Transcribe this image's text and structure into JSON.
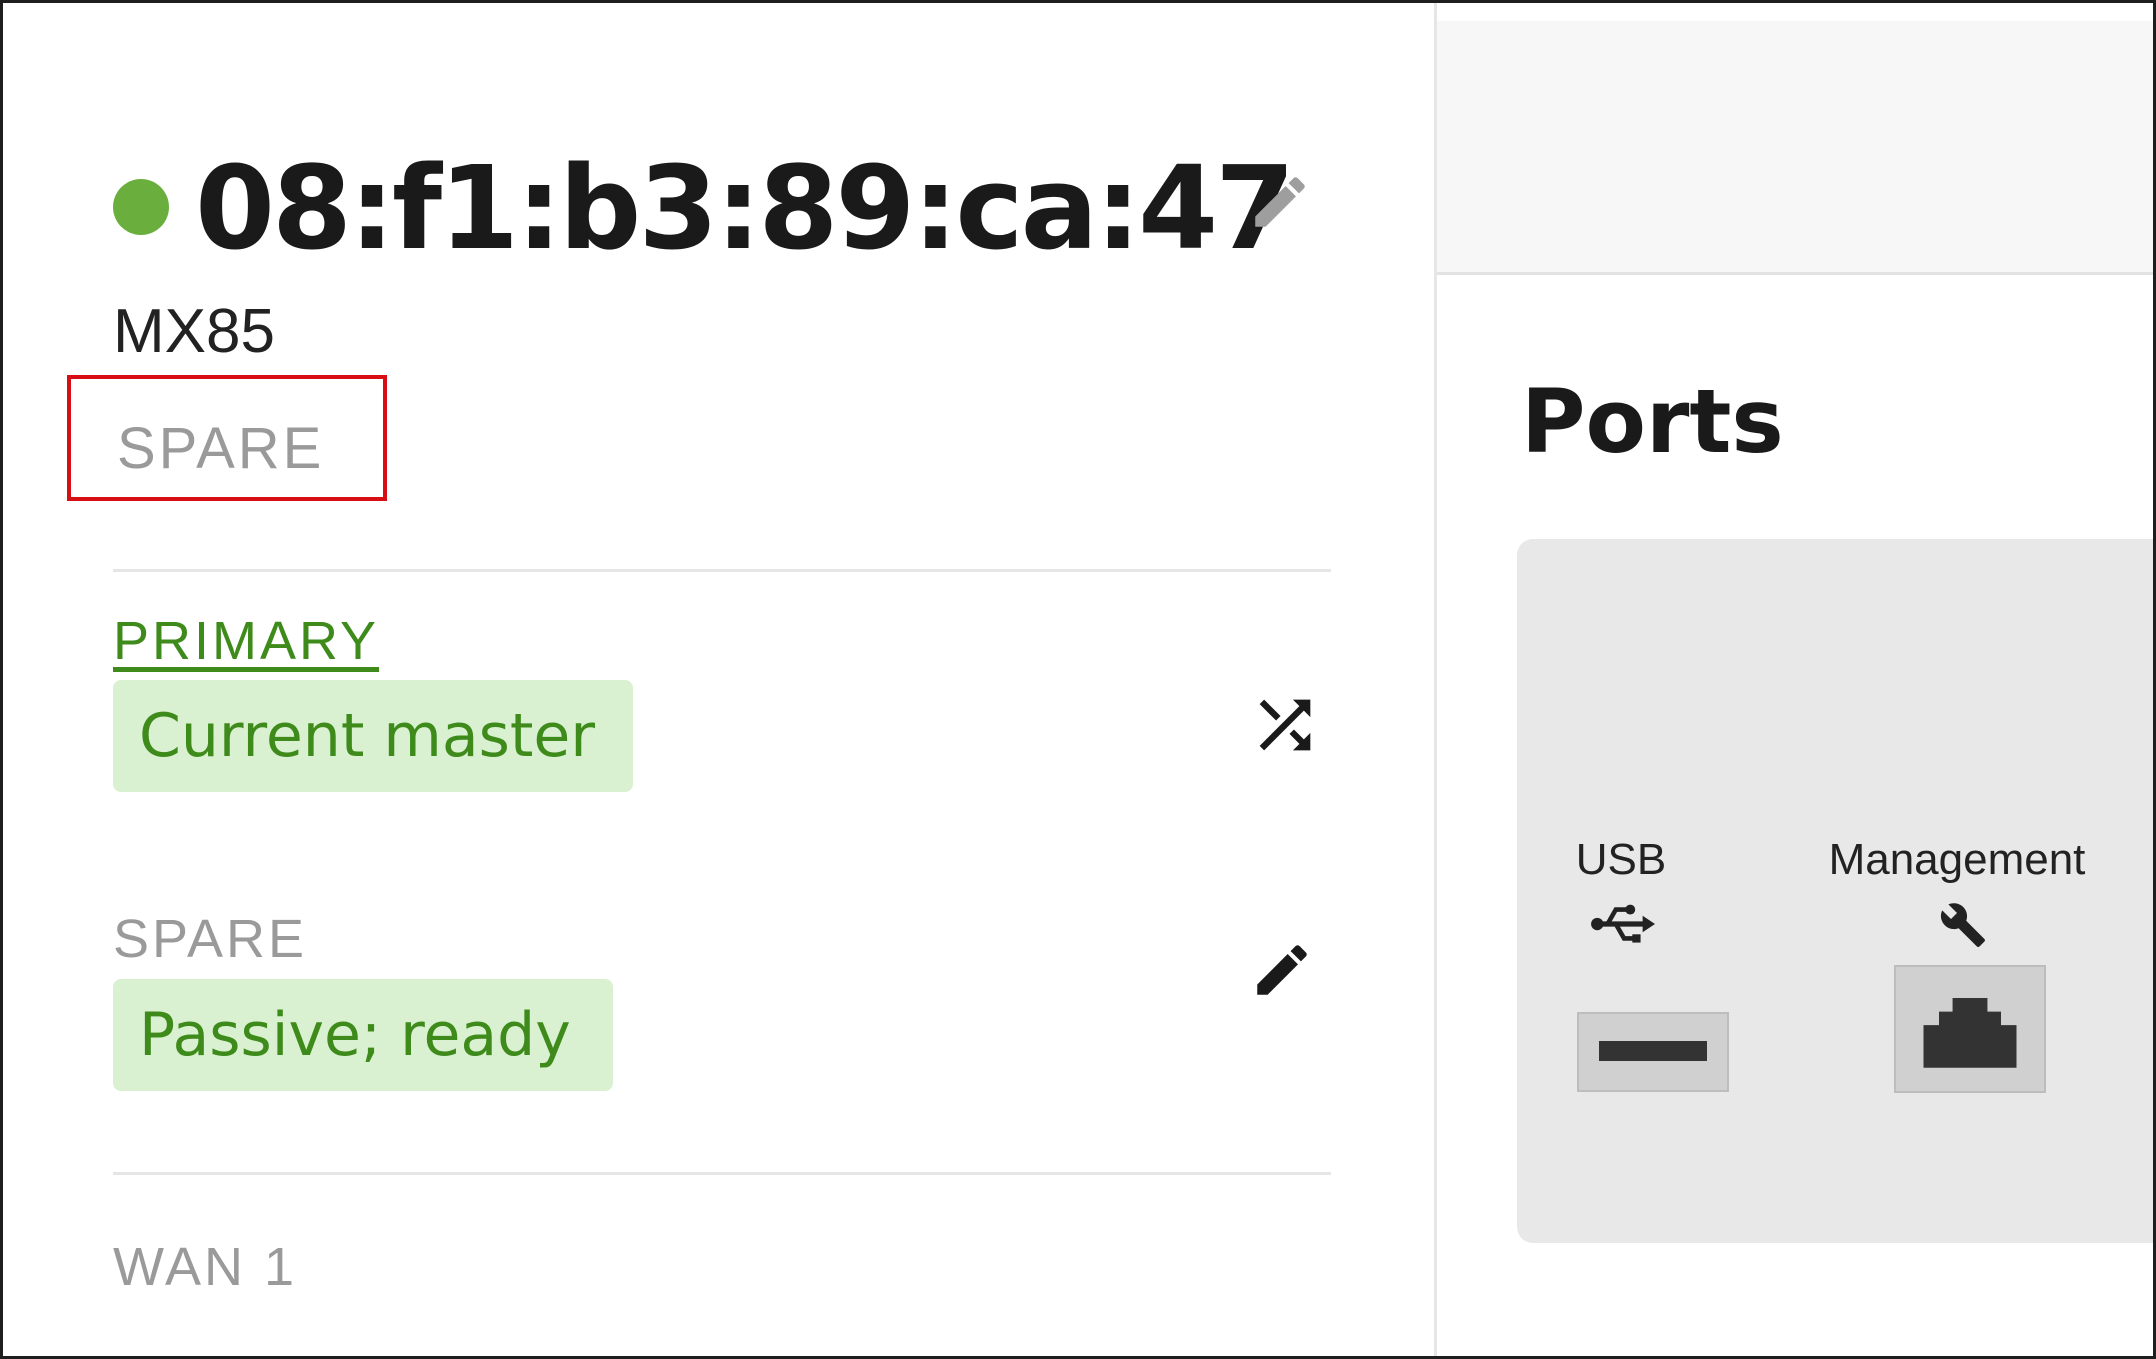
{
  "device": {
    "status_color": "#6aaf3d",
    "title": "08:f1:b3:89:ca:47",
    "model": "MX85",
    "role": "SPARE"
  },
  "ha": {
    "primary_label": "PRIMARY",
    "primary_status": "Current master",
    "spare_label": "SPARE",
    "spare_status": "Passive; ready",
    "wan_label": "WAN 1"
  },
  "ports": {
    "title": "Ports",
    "items": [
      {
        "label": "USB",
        "icon": "usb-icon"
      },
      {
        "label": "Management",
        "icon": "wrench-icon"
      }
    ]
  },
  "colors": {
    "accent_green": "#3e8b1c",
    "badge_bg": "#d9f1d0",
    "highlight_red": "#d70f15"
  }
}
